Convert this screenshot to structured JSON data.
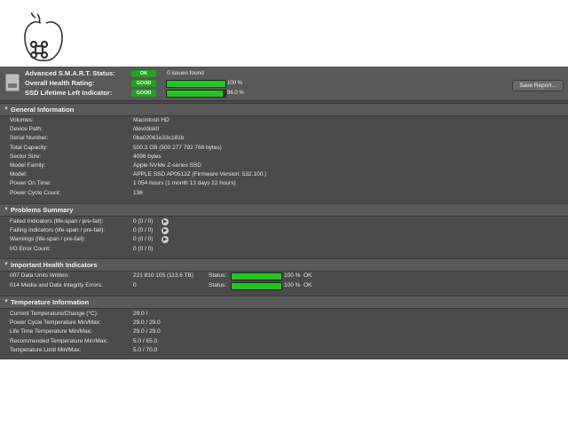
{
  "status": {
    "smart": {
      "label": "Advanced S.M.A.R.T. Status:",
      "badge": "OK",
      "text": "0 issues found"
    },
    "health": {
      "label": "Overall Health Rating:",
      "badge": "GOOD",
      "percent_text": "100 %",
      "fill": 1.0
    },
    "lifetime": {
      "label": "SSD Lifetime Left Indicator:",
      "badge": "GOOD",
      "percent_text": "96.0 %",
      "fill": 0.96
    },
    "save_label": "Save Report...",
    "badge_color": "#1fa51f",
    "bar_color": "#22c522"
  },
  "general": {
    "title": "General Information",
    "rows": [
      {
        "k": "Volumes:",
        "v": "Macintosh HD"
      },
      {
        "k": "Device Path:",
        "v": "/dev/disk0"
      },
      {
        "k": "Serial Number:",
        "v": "0ba02061e33c181b"
      },
      {
        "k": "Total Capacity:",
        "v": "500.3 GB (500 277 792 768 bytes)"
      },
      {
        "k": "Sector Size:",
        "v": "4096 bytes"
      },
      {
        "k": "Model Family:",
        "v": "Apple NVMe Z-series SSD"
      },
      {
        "k": "Model:",
        "v": "APPLE SSD AP0512Z  (Firmware Version: 532.100.)"
      },
      {
        "k": "Power On Time:",
        "v": "1 054 hours (1 month 13 days 22 hours)"
      },
      {
        "k": "Power Cycle Count:",
        "v": "136"
      }
    ]
  },
  "problems": {
    "title": "Problems Summary",
    "rows": [
      {
        "k": "Failed Indicators (life-span / pre-fail):",
        "v": "0 (0 / 0)"
      },
      {
        "k": "Failing Indicators (life-span / pre-fail):",
        "v": "0 (0 / 0)"
      },
      {
        "k": "Warnings (life-span / pre-fail):",
        "v": "0 (0 / 0)"
      },
      {
        "k": "I/O Error Count:",
        "v": "0 (0 / 0)"
      }
    ]
  },
  "health_ind": {
    "title": "Important Health Indicators",
    "rows": [
      {
        "k": "007  Data Units Written:",
        "v": "221 810 105 (113.6 TB)",
        "status": "Status:",
        "pct": "100 %",
        "ok": "OK",
        "fill": 1.0
      },
      {
        "k": "014  Media and Data Integrity Errors:",
        "v": "0",
        "status": "Status:",
        "pct": "100 %",
        "ok": "OK",
        "fill": 1.0
      }
    ]
  },
  "temperature": {
    "title": "Temperature Information",
    "rows": [
      {
        "k": "Current Temperature/Change (°C):",
        "v": "29.0 /"
      },
      {
        "k": "Power Cycle Temperature Min/Max:",
        "v": "29.0 / 29.0"
      },
      {
        "k": "Life Time Temperature Min/Max:",
        "v": "29.0 / 29.0"
      },
      {
        "k": "Recommended Temperature Min/Max:",
        "v": "5.0  / 65.0"
      },
      {
        "k": "Temperature Limit Min/Max:",
        "v": "5.0  / 70.0"
      }
    ]
  }
}
